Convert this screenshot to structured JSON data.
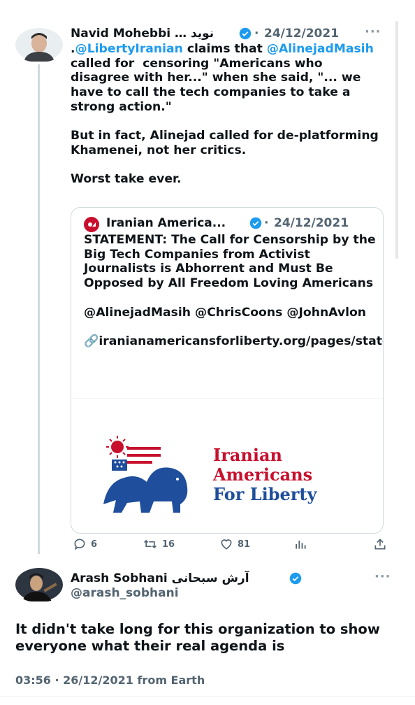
{
  "tweet1": {
    "name": "Navid Mohebbi … نوید",
    "separator": "·",
    "date": "24/12/2021",
    "more": "···",
    "body_segments": [
      {
        "text": ".",
        "type": "text"
      },
      {
        "text": "@LibertyIranian",
        "type": "mention"
      },
      {
        "text": " claims that ",
        "type": "text"
      },
      {
        "text": "@AlinejadMasih",
        "type": "mention"
      },
      {
        "text": " called for  censoring \"Americans who disagree with her...\" when she said, \"... we have to call the tech companies to take a strong action.\"\n\nBut in fact, Alinejad called for de-platforming Khamenei, not her critics.\n\nWorst take ever.",
        "type": "text"
      }
    ],
    "quote": {
      "name": "Iranian America...",
      "separator": "·",
      "date": "24/12/2021",
      "body": "STATEMENT: The Call for Censorship by the Big Tech Companies from Activist Journalists is Abhorrent and Must Be Opposed by All Freedom Loving Americans\n\n@AlinejadMasih @ChrisCoons @JohnAvlon\n\n🔗iranianamericansforliberty.org/pages/statemen...",
      "logo_lines": [
        "Iranian",
        "Americans",
        "For Liberty"
      ]
    },
    "actions": {
      "replies": "6",
      "retweets": "16",
      "likes": "81"
    }
  },
  "tweet2": {
    "name": "Arash Sobhani آرش سبحانی",
    "handle": "@arash_sobhani",
    "more": "···",
    "body": "It didn't take long for this organization to show everyone what their real agenda is",
    "meta": "03:56 · 26/12/2021 from Earth"
  },
  "colors": {
    "accent": "#1d9bf0",
    "text": "#0f1419",
    "muted": "#536471",
    "logo_red": "#c8102e",
    "logo_blue": "#1f4e9c"
  }
}
